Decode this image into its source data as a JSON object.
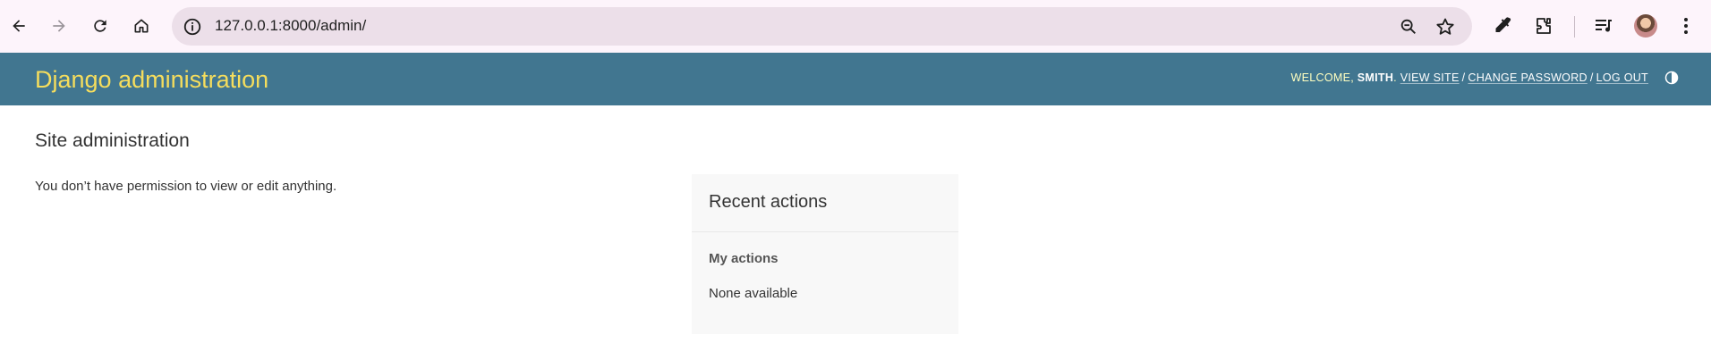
{
  "browser": {
    "url": "127.0.0.1:8000/admin/"
  },
  "header": {
    "branding": "Django administration",
    "welcome": "WELCOME,",
    "username": "SMITH",
    "view_site": "VIEW SITE",
    "change_password": "CHANGE PASSWORD",
    "log_out": "LOG OUT",
    "separator": "/",
    "colors": {
      "background": "#417690",
      "branding": "#f5dd5d"
    }
  },
  "content": {
    "title": "Site administration",
    "permission_message": "You don’t have permission to view or edit anything."
  },
  "recent_actions": {
    "title": "Recent actions",
    "my_actions": "My actions",
    "empty": "None available"
  }
}
